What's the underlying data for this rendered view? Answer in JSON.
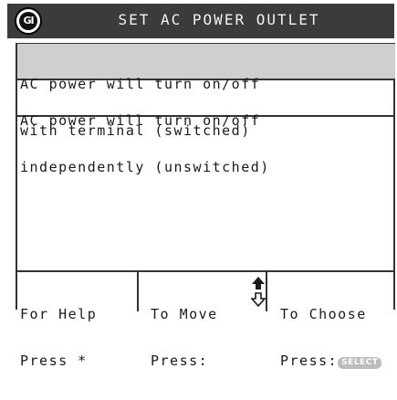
{
  "header": {
    "logo_text": "GI",
    "title": "SET AC POWER OUTLET"
  },
  "options": [
    {
      "line1": "AC power will turn on/off",
      "line2": "with terminal (switched)",
      "selected": true
    },
    {
      "line1": "AC power will turn on/off",
      "line2": "independently (unswitched)",
      "selected": false
    }
  ],
  "footer": {
    "help": {
      "line1": "For Help",
      "line2": "Press *"
    },
    "move": {
      "line1": "To Move",
      "line2": "Press:",
      "icon": "up-down-arrow-icon"
    },
    "choose": {
      "line1": "To Choose",
      "line2": "Press:",
      "key_label": "SELECT"
    }
  },
  "colors": {
    "header_bg": "#3b3b3b",
    "selected_bg": "#cfcfcf",
    "key_bg": "#bdbdbd"
  }
}
